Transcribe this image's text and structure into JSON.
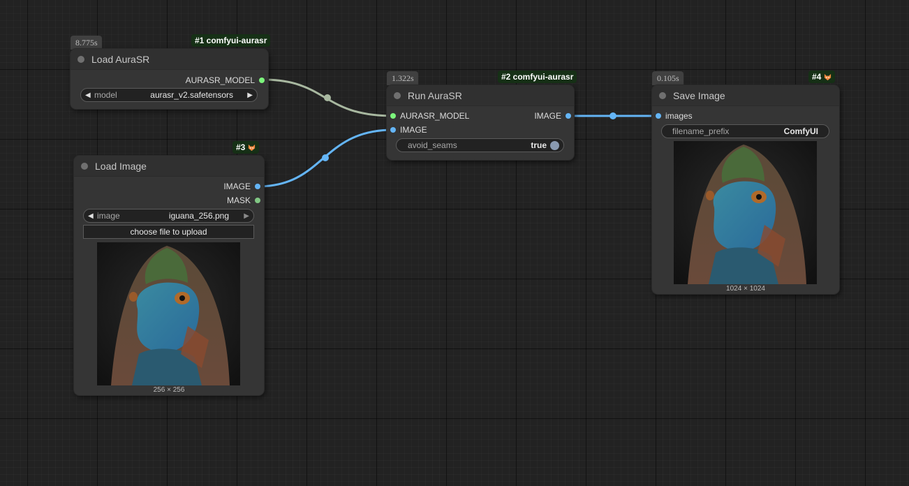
{
  "nodes": {
    "load_aurasr": {
      "time": "8.775s",
      "badge": "#1 comfyui-aurasr",
      "title": "Load AuraSR",
      "output": "AURASR_MODEL",
      "widget_label": "model",
      "widget_value": "aurasr_v2.safetensors"
    },
    "run_aurasr": {
      "time": "1.322s",
      "badge": "#2 comfyui-aurasr",
      "title": "Run AuraSR",
      "input_model": "AURASR_MODEL",
      "input_image": "IMAGE",
      "output": "IMAGE",
      "widget_label": "avoid_seams",
      "widget_value": "true"
    },
    "load_image": {
      "badge": "#3",
      "title": "Load Image",
      "output_image": "IMAGE",
      "output_mask": "MASK",
      "widget_label": "image",
      "widget_value": "iguana_256.png",
      "upload_button": "choose file to upload",
      "caption": "256 × 256"
    },
    "save_image": {
      "time": "0.105s",
      "badge": "#4",
      "title": "Save Image",
      "input": "images",
      "widget_label": "filename_prefix",
      "widget_value": "ComfyUI",
      "caption": "1024 × 1024"
    }
  },
  "colors": {
    "image_link": "#64b5f6",
    "model_link": "#a8b8a0",
    "model_slot": "#7cf57c",
    "mask_slot": "#81c784",
    "badge_bg": "#163016",
    "node_bg": "#353535"
  },
  "icons": [
    "fox-icon",
    "left-arrow-icon",
    "right-arrow-icon"
  ]
}
